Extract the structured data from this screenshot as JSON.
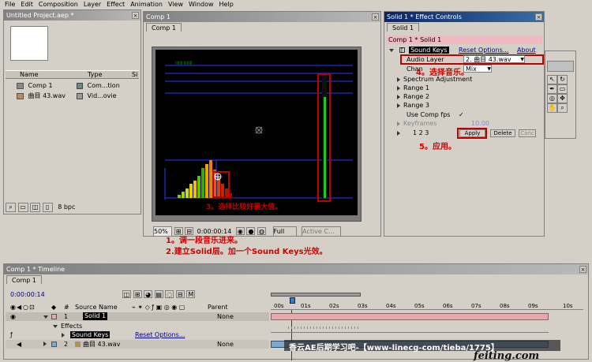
{
  "menu": [
    "File",
    "Edit",
    "Composition",
    "Layer",
    "Effect",
    "Animation",
    "View",
    "Window",
    "Help"
  ],
  "project": {
    "title": "Untitled Project.aep *",
    "col_name": "Name",
    "col_type": "Type",
    "col_size": "Si",
    "items": [
      {
        "name": "Comp 1",
        "type": "Com...tion"
      },
      {
        "name": "曲目 43.wav",
        "type": "Vid...ovie"
      }
    ],
    "bpc": "8 bpc"
  },
  "comp_viewer": {
    "title": "Comp 1",
    "tab": "Comp 1",
    "zoom": "50%",
    "timecode": "0:00:00:14",
    "resolution": "Full",
    "camera": "Active C..."
  },
  "effect_controls": {
    "title": "Solid 1 * Effect Controls",
    "tab": "Solid 1",
    "header": "Comp 1 * Solid 1",
    "effect_name": "Sound Keys",
    "reset": "Reset Options...",
    "about": "About",
    "audio_layer_label": "Audio Layer",
    "audio_layer_value": "2. 曲目 43.wav",
    "channel_label": "Chan",
    "channel_value": "Mix",
    "props": [
      "Spectrum Adjustment",
      "Range 1",
      "Range 2",
      "Range 3"
    ],
    "use_comp_fps": "Use Comp fps",
    "keyframes_label": "Keyframes",
    "keyframes_value": "10.00",
    "range_nums": "1 2 3",
    "apply": "Apply",
    "delete": "Delete",
    "cancel": "Canc"
  },
  "annotations": {
    "step1": "1。调一段音乐进来。",
    "step2": "2.建立Solid层。加一个Sound Keys光效。",
    "step3": "3。选择比较好最大值。",
    "step4": "4。选择音乐。",
    "step5": "5。应用。"
  },
  "timeline": {
    "title": "Comp 1 * Timeline",
    "tab": "Comp 1",
    "timecode": "0:00:00:14",
    "col_num": "#",
    "col_source": "Source Name",
    "col_parent": "Parent",
    "layers": [
      {
        "num": "1",
        "name": "Solid 1",
        "parent": "None"
      },
      {
        "num": "2",
        "name": "曲目 43.wav",
        "parent": "None"
      }
    ],
    "effects_label": "Effects",
    "effect_row": "Sound Keys",
    "effect_reset": "Reset Options...",
    "ticks": [
      "00s",
      "01s",
      "02s",
      "03s",
      "04s",
      "05s",
      "06s",
      "07s",
      "08s",
      "09s",
      "10s"
    ]
  },
  "watermark": "香云AE后期学习吧-【www-linecg-com/tieba/1775】",
  "watermark_logo": "feiting.com",
  "colors": {
    "titlebar_active": "#0a246a",
    "annotation_red": "#d40000",
    "meter_green": "#22c822",
    "layer_pink": "#e8a8b0",
    "layer_blue": "#7fa7c8"
  }
}
